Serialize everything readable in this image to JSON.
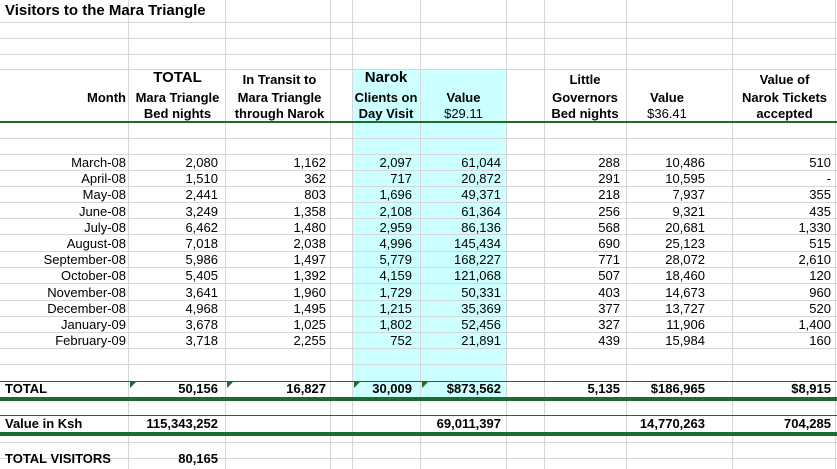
{
  "title": "Visitors to the Mara Triangle",
  "headers": {
    "month": "Month",
    "total_l1": "TOTAL",
    "total_l2": "Mara Triangle",
    "total_l3": "Bed nights",
    "transit_l1": "In Transit to",
    "transit_l2": "Mara Triangle",
    "transit_l3": "through Narok",
    "narok_l1": "Narok",
    "narok_clients_l2": "Clients on",
    "narok_clients_l3": "Day Visit",
    "narok_value_l2": "Value",
    "narok_value_l3": "$29.11",
    "lg_l1": "Little",
    "lg_l2": "Governors",
    "lg_l3": "Bed nights",
    "lg_value_l2": "Value",
    "lg_value_l3": "$36.41",
    "tickets_l1": "Value of",
    "tickets_l2": "Narok Tickets",
    "tickets_l3": "accepted"
  },
  "rows": [
    {
      "month": "March-08",
      "total": "2,080",
      "transit": "1,162",
      "narok_clients": "2,097",
      "narok_value": "61,044",
      "lg_beds": "288",
      "lg_value": "10,486",
      "tickets": "510"
    },
    {
      "month": "April-08",
      "total": "1,510",
      "transit": "362",
      "narok_clients": "717",
      "narok_value": "20,872",
      "lg_beds": "291",
      "lg_value": "10,595",
      "tickets": "-"
    },
    {
      "month": "May-08",
      "total": "2,441",
      "transit": "803",
      "narok_clients": "1,696",
      "narok_value": "49,371",
      "lg_beds": "218",
      "lg_value": "7,937",
      "tickets": "355"
    },
    {
      "month": "June-08",
      "total": "3,249",
      "transit": "1,358",
      "narok_clients": "2,108",
      "narok_value": "61,364",
      "lg_beds": "256",
      "lg_value": "9,321",
      "tickets": "435"
    },
    {
      "month": "July-08",
      "total": "6,462",
      "transit": "1,480",
      "narok_clients": "2,959",
      "narok_value": "86,136",
      "lg_beds": "568",
      "lg_value": "20,681",
      "tickets": "1,330"
    },
    {
      "month": "August-08",
      "total": "7,018",
      "transit": "2,038",
      "narok_clients": "4,996",
      "narok_value": "145,434",
      "lg_beds": "690",
      "lg_value": "25,123",
      "tickets": "515"
    },
    {
      "month": "September-08",
      "total": "5,986",
      "transit": "1,497",
      "narok_clients": "5,779",
      "narok_value": "168,227",
      "lg_beds": "771",
      "lg_value": "28,072",
      "tickets": "2,610"
    },
    {
      "month": "October-08",
      "total": "5,405",
      "transit": "1,392",
      "narok_clients": "4,159",
      "narok_value": "121,068",
      "lg_beds": "507",
      "lg_value": "18,460",
      "tickets": "120"
    },
    {
      "month": "November-08",
      "total": "3,641",
      "transit": "1,960",
      "narok_clients": "1,729",
      "narok_value": "50,331",
      "lg_beds": "403",
      "lg_value": "14,673",
      "tickets": "960"
    },
    {
      "month": "December-08",
      "total": "4,968",
      "transit": "1,495",
      "narok_clients": "1,215",
      "narok_value": "35,369",
      "lg_beds": "377",
      "lg_value": "13,727",
      "tickets": "520"
    },
    {
      "month": "January-09",
      "total": "3,678",
      "transit": "1,025",
      "narok_clients": "1,802",
      "narok_value": "52,456",
      "lg_beds": "327",
      "lg_value": "11,906",
      "tickets": "1,400"
    },
    {
      "month": "February-09",
      "total": "3,718",
      "transit": "2,255",
      "narok_clients": "752",
      "narok_value": "21,891",
      "lg_beds": "439",
      "lg_value": "15,984",
      "tickets": "160"
    }
  ],
  "totals": {
    "label": "TOTAL",
    "total": "50,156",
    "transit": "16,827",
    "narok_clients": "30,009",
    "narok_value": "$873,562",
    "lg_beds": "5,135",
    "lg_value": "$186,965",
    "tickets": "$8,915"
  },
  "ksh": {
    "label": "Value in Ksh",
    "total": "115,343,252",
    "narok_value": "69,011,397",
    "lg_value": "14,770,263",
    "tickets": "704,285"
  },
  "visitors": {
    "label": "TOTAL VISITORS",
    "value": "80,165"
  },
  "colors": {
    "highlight": "#ccffff",
    "rule": "#1e6b2e",
    "grid": "#d6d6d6"
  }
}
